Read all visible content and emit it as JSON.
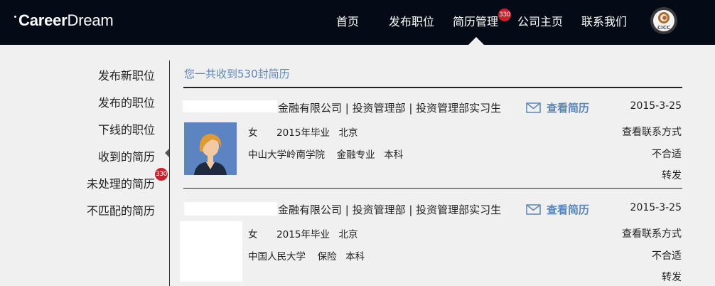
{
  "header": {
    "logo_bold": "Career",
    "logo_light": "Dream",
    "nav": [
      {
        "label": "首页"
      },
      {
        "label": "发布职位"
      },
      {
        "label": "简历管理",
        "badge": "330"
      },
      {
        "label": "公司主页"
      },
      {
        "label": "联系我们"
      }
    ],
    "user_logo": "CICC"
  },
  "sidebar": {
    "items": [
      {
        "label": "发布新职位"
      },
      {
        "label": "发布的职位"
      },
      {
        "label": "下线的职位"
      },
      {
        "label": "收到的简历",
        "active": true
      },
      {
        "label": "未处理的简历",
        "badge": "330"
      },
      {
        "label": "不匹配的简历"
      }
    ]
  },
  "main": {
    "total_text": "您一共收到530封简历",
    "resumes": [
      {
        "title": "金融有限公司 | 投资管理部 | 投资管理部实习生",
        "view_label": "查看简历",
        "date": "2015-3-25",
        "gender": "女",
        "graduation": "2015年毕业",
        "city": "北京",
        "school": "中山大学岭南学院",
        "major": "金融专业",
        "degree": "本科",
        "actions": [
          "查看联系方式",
          "不合适",
          "转发"
        ]
      },
      {
        "title": "金融有限公司 | 投资管理部 | 投资管理部实习生",
        "view_label": "查看简历",
        "date": "2015-3-25",
        "gender": "女",
        "graduation": "2015年毕业",
        "city": "北京",
        "school": "中国人民大学",
        "major": "保险",
        "degree": "本科",
        "actions": [
          "查看联系方式",
          "不合适",
          "转发"
        ]
      }
    ]
  },
  "colors": {
    "header_bg": "#050b16",
    "accent": "#5c86b6",
    "badge": "#c8202c",
    "page_bg": "#f0f0f0"
  },
  "icons": [
    "mail-icon",
    "avatar-female-icon",
    "company-logo-icon"
  ]
}
